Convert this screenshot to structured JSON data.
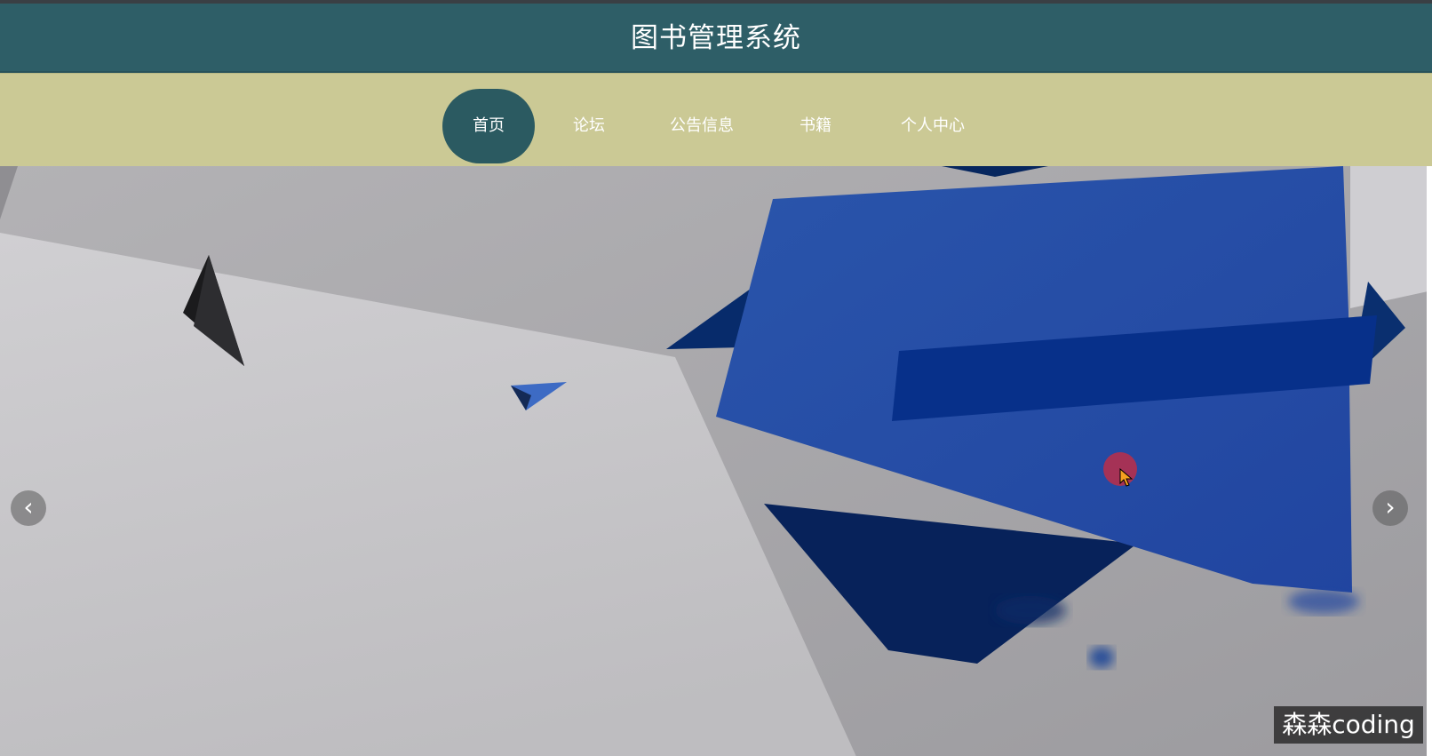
{
  "header": {
    "title": "图书管理系统"
  },
  "nav": {
    "items": [
      {
        "label": "首页",
        "active": true
      },
      {
        "label": "论坛",
        "active": false
      },
      {
        "label": "公告信息",
        "active": false
      },
      {
        "label": "书籍",
        "active": false
      },
      {
        "label": "个人中心",
        "active": false
      }
    ]
  },
  "banner": {
    "prev_icon": "chevron-left-icon",
    "next_icon": "chevron-right-icon",
    "prev_glyph": "‹",
    "next_glyph": "›"
  },
  "watermark": {
    "text": "森森coding"
  },
  "colors": {
    "header_bg": "#2e5e67",
    "nav_bg": "#cbc995",
    "nav_active_bg": "#2b5a61",
    "banner_blue": "#2449a0",
    "banner_dark_blue": "#062a6a"
  }
}
